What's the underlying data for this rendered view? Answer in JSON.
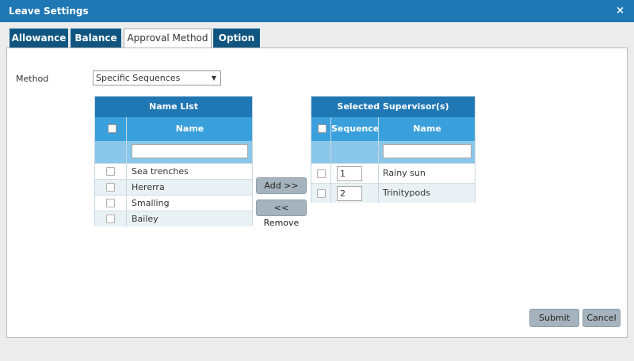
{
  "window": {
    "title": "Leave Settings",
    "close_glyph": "×"
  },
  "tabs": [
    {
      "label": "Allowance",
      "active": false
    },
    {
      "label": "Balance",
      "active": false
    },
    {
      "label": "Approval Method",
      "active": true
    },
    {
      "label": "Option",
      "active": false
    }
  ],
  "method": {
    "label": "Method",
    "value": "Specific Sequences",
    "arrow": "▼"
  },
  "name_list": {
    "title": "Name List",
    "column": "Name",
    "rows": [
      "Sea trenches",
      "Hererra",
      "Smalling",
      "Bailey"
    ]
  },
  "buttons": {
    "add": "Add >>",
    "remove": "<< Remove",
    "submit": "Submit",
    "cancel": "Cancel"
  },
  "selected": {
    "title": "Selected Supervisor(s)",
    "col_sequence": "Sequence",
    "col_name": "Name",
    "rows": [
      {
        "sequence": "1",
        "name": "Rainy sun"
      },
      {
        "sequence": "2",
        "name": "Trinitypods"
      }
    ]
  }
}
